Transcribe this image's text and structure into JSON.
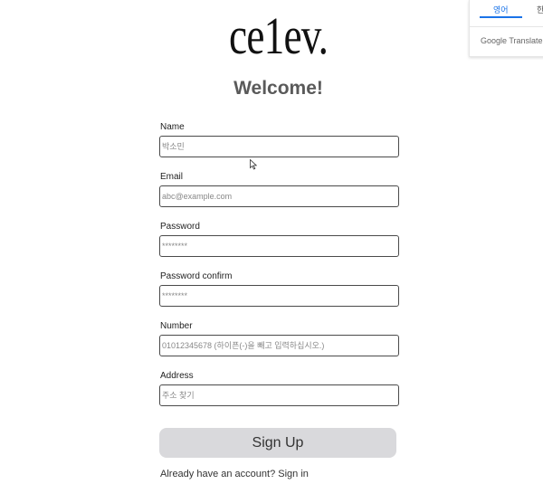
{
  "header": {
    "logo_text": "ce1ev.",
    "welcome": "Welcome!"
  },
  "form": {
    "name": {
      "label": "Name",
      "placeholder": "박소민"
    },
    "email": {
      "label": "Email",
      "placeholder": "abc@example.com"
    },
    "password": {
      "label": "Password",
      "placeholder": "********"
    },
    "password_confirm": {
      "label": "Password confirm",
      "placeholder": "********"
    },
    "number": {
      "label": "Number",
      "placeholder": "01012345678 (하이픈(-)을 빼고 입력하십시오.)"
    },
    "address": {
      "label": "Address",
      "placeholder": "주소 찾기"
    },
    "submit_label": "Sign Up",
    "signin_text": "Already have an account? Sign in"
  },
  "translate_popup": {
    "tab_active": "영어",
    "tab_inactive": "한",
    "brand": "Google Translate",
    "accent": "#1a73e8"
  }
}
